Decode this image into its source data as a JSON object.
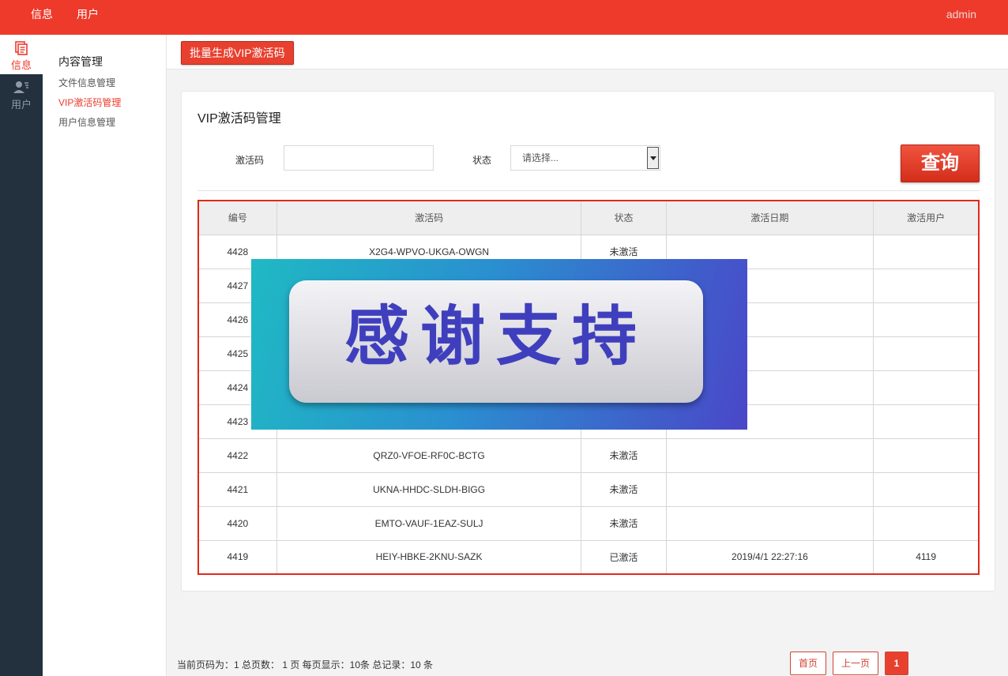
{
  "topbar": {
    "nav": [
      "信息",
      "用户"
    ],
    "user": "admin"
  },
  "rail": {
    "items": [
      {
        "label": "信息",
        "icon": "document-icon",
        "active": true
      },
      {
        "label": "用户",
        "icon": "user-list-icon",
        "active": false
      }
    ]
  },
  "submenu": {
    "title": "内容管理",
    "items": [
      {
        "label": "文件信息管理",
        "active": false
      },
      {
        "label": "VIP激活码管理",
        "active": true
      },
      {
        "label": "用户信息管理",
        "active": false
      }
    ]
  },
  "toolbar": {
    "batch_label": "批量生成VIP激活码"
  },
  "main": {
    "title": "VIP激活码管理",
    "filters": {
      "code_label": "激活码",
      "code_value": "",
      "status_label": "状态",
      "status_selected": "请选择...",
      "query_label": "查询"
    },
    "table": {
      "columns": [
        "编号",
        "激活码",
        "状态",
        "激活日期",
        "激活用户"
      ],
      "rows": [
        [
          "4428",
          "X2G4-WPVO-UKGA-OWGN",
          "未激活",
          "",
          ""
        ],
        [
          "4427",
          "",
          "",
          "",
          ""
        ],
        [
          "4426",
          "",
          "",
          "",
          ""
        ],
        [
          "4425",
          "",
          "",
          "",
          ""
        ],
        [
          "4424",
          "",
          "",
          "",
          ""
        ],
        [
          "4423",
          "",
          "",
          "",
          ""
        ],
        [
          "4422",
          "QRZ0-VFOE-RF0C-BCTG",
          "未激活",
          "",
          ""
        ],
        [
          "4421",
          "UKNA-HHDC-SLDH-BIGG",
          "未激活",
          "",
          ""
        ],
        [
          "4420",
          "EMTO-VAUF-1EAZ-SULJ",
          "未激活",
          "",
          ""
        ],
        [
          "4419",
          "HEIY-HBKE-2KNU-SAZK",
          "已激活",
          "2019/4/1 22:27:16",
          "4119"
        ]
      ]
    }
  },
  "overlay": {
    "text": "感谢支持"
  },
  "pager": {
    "info": "当前页码为：1 总页数： 1 页 每页显示：10条 总记录：10 条",
    "first": "首页",
    "prev": "上一页",
    "current": "1"
  },
  "colors": {
    "accent": "#ed3a2b",
    "rail": "#22313d"
  }
}
